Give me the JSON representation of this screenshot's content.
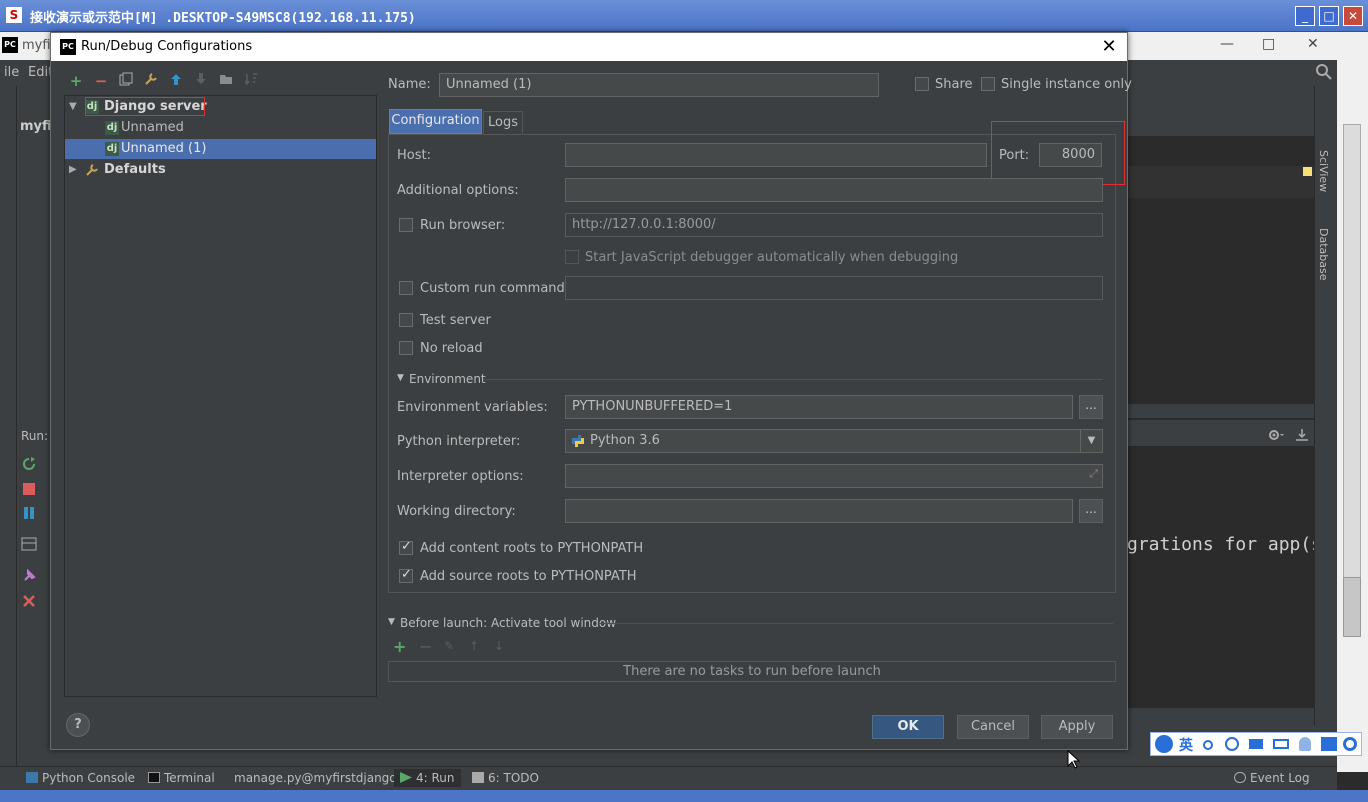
{
  "remote": {
    "title": "接收演示或示范中[M] .DESKTOP-S49MSC8(192.168.11.175)",
    "minimize": "_",
    "maximize": "□",
    "close": "✕"
  },
  "ide": {
    "title": "myfir",
    "menu": [
      "ile",
      "Edit"
    ],
    "project_short": "myfir",
    "run_label": "Run:",
    "console_line": "grations for app(s",
    "side_tools": [
      "SciView",
      "Database"
    ],
    "bottom_tabs": [
      "Python Console",
      "Terminal",
      "manage.py@myfirstdjango",
      "4: Run",
      "6: TODO"
    ],
    "event_log": "Event Log",
    "close": "✕",
    "minimize": "—",
    "maximize": "□"
  },
  "dialog": {
    "title": "Run/Debug Configurations",
    "close": "✕",
    "tree": {
      "root": "Django server",
      "children": [
        "Unnamed",
        "Unnamed (1)"
      ],
      "defaults": "Defaults"
    },
    "name_label": "Name:",
    "name_value": "Unnamed (1)",
    "share_label": "Share",
    "single_instance_label": "Single instance only",
    "tabs": [
      "Configuration",
      "Logs"
    ],
    "host_label": "Host:",
    "host_value": "",
    "port_label": "Port:",
    "port_value": "8000",
    "additional_options_label": "Additional options:",
    "run_browser_label": "Run browser:",
    "run_browser_url": "http://127.0.0.1:8000/",
    "js_debugger_label": "Start JavaScript debugger automatically when debugging",
    "custom_run_label": "Custom run command:",
    "test_server_label": "Test server",
    "no_reload_label": "No reload",
    "environment_section": "Environment",
    "env_vars_label": "Environment variables:",
    "env_vars_value": "PYTHONUNBUFFERED=1",
    "interpreter_label": "Python interpreter:",
    "interpreter_value": "Python 3.6",
    "interp_options_label": "Interpreter options:",
    "working_dir_label": "Working directory:",
    "add_content_roots_label": "Add content roots to PYTHONPATH",
    "add_source_roots_label": "Add source roots to PYTHONPATH",
    "before_launch_label": "Before launch: Activate tool window",
    "no_tasks_text": "There are no tasks to run before launch",
    "browse": "...",
    "ok": "OK",
    "cancel": "Cancel",
    "apply": "Apply",
    "help": "?"
  },
  "ime": {
    "lang": "英"
  },
  "colors": {
    "accent": "#4b6eaf",
    "highlight_box": "#e03030",
    "ok_button": "#365880"
  }
}
